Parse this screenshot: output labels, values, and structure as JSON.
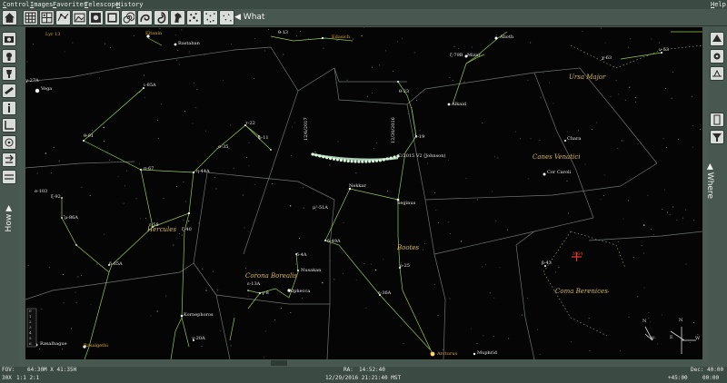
{
  "menu": {
    "items": [
      "Control",
      "Images",
      "Favorites",
      "Telescope",
      "History"
    ],
    "help": "Help"
  },
  "toolbar": {
    "what_label": "What",
    "icons": [
      "home-icon",
      "grid-icon",
      "grid-detail-icon",
      "constellation-icon",
      "image-icon",
      "picture-icon",
      "spiral-icon",
      "horse-head-icon",
      "star-cluster-icon",
      "sparkle-icon"
    ]
  },
  "left_panel": {
    "label": "How"
  },
  "right_panel": {
    "label": "Where"
  },
  "sky": {
    "constellations": [
      "Hercules",
      "Corona Borealis",
      "Bootes",
      "Canes Venatici",
      "Ursa Major",
      "Coma Berenices"
    ],
    "comet_dates": [
      "12/6/2017",
      "12/30/2016"
    ],
    "comet_name": "C/2015 V2 (Johnson)",
    "stars": {
      "vega": "Vega",
      "lyr": "Lyr 13",
      "rastaban": "Rastaban",
      "eltanin": "Eltanin",
      "edasich": "Edasich",
      "thuban": "Thuban",
      "alioth": "Alioth",
      "mizar": "Mizar",
      "alkaid": "Alkaid",
      "chara": "Chara",
      "cor_caroli": "Cor Caroli",
      "nekkar": "Nekkar",
      "seginus": "Seginus",
      "alphecca": "Alphecca",
      "nusakan": "Nusakan",
      "kornephoros": "Kornephoros",
      "arcturus": "Arcturus",
      "muphrid": "Muphrid",
      "rasalhague": "Rasalhague",
      "rasalgethi": "Rasalgethi",
      "st_23": "θ-23",
      "st_19": "λ-19",
      "st_91": "θ-91",
      "st_67": "π-67",
      "st_44": "η-44A",
      "st_22": "τ-22",
      "st_35": "σ-35",
      "st_11": "φ-11",
      "st_65a": "ι-85A",
      "st_58": "ε-58",
      "st_40": "ζ-40",
      "st_86a": "μ-86A",
      "st_103": "ο-103",
      "st_92": "ξ-92",
      "st_65": "δ-65A",
      "st_51a": "μ¹-51A",
      "st_49a": "δ-49A",
      "st_25": "ρ-25",
      "st_36a": "ε-36A",
      "st_13a": "ε-13A",
      "st_3": "γ-8",
      "st_4a": "δ-4A",
      "st_13": "θ-13",
      "st_79": "ζ-79B",
      "st_53": "ν-53",
      "st_63": "χ-63",
      "st_43": "β-43",
      "st_27a": "γ-27A",
      "st_20a": "γ-20A",
      "mizar_sub": "Mizar"
    },
    "galaxy_marker": "M64",
    "compass": {
      "n": "N",
      "e": "E",
      "w": "W",
      "s": "S"
    }
  },
  "legend_scale": [
    "0",
    "1",
    "2",
    "3",
    "4",
    "5",
    "6"
  ],
  "status": {
    "fov_label": "FOV:",
    "fov_value": "64:30M X 41:35H",
    "scale_label": "30X",
    "scale_value": "1:1 2:1",
    "ra_label": "RA:",
    "ra_value": "14:52:40",
    "datetime": "12/29/2016 21:21:40 MST",
    "dec_label": "Dec:",
    "dec_value": "40:00",
    "alt_value": "+45:00",
    "az_value": "00:00"
  },
  "colors": {
    "background": "#050505",
    "constellation_line": "#9ac94a",
    "boundary_line": "#6f7671",
    "constellation_name": "#d7b75a",
    "star_label": "#e8e8e8",
    "highlight_label": "#d9a83a",
    "comet": "#c9f0d2",
    "marker": "#e23a2a"
  }
}
